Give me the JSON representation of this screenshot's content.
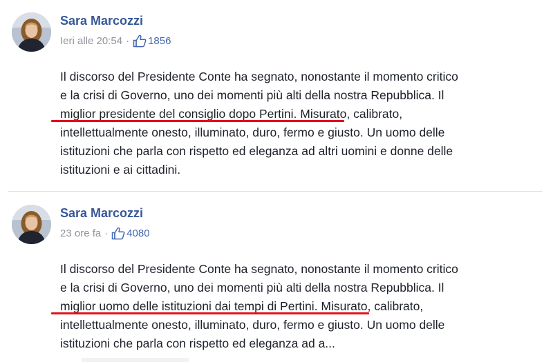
{
  "posts": [
    {
      "author": "Sara Marcozzi",
      "time": "Ieri alle 20:54",
      "separator": "·",
      "likes": "1856",
      "lines": [
        "Il discorso del Presidente Conte ha segnato, nonostante il momento critico",
        "e la crisi di Governo, uno dei momenti più alti della nostra Repubblica. Il",
        "miglior presidente del consiglio dopo Pertini. Misurato, calibrato,",
        "intellettualmente onesto, illuminato, duro, fermo e giusto. Un uomo delle",
        "istituzioni che parla con rispetto ed eleganza ad altri uomini e donne delle",
        "istituzioni e ai cittadini."
      ]
    },
    {
      "author": "Sara Marcozzi",
      "time": "23 ore fa",
      "separator": "·",
      "likes": "4080",
      "lines": [
        "Il discorso del Presidente Conte ha segnato, nonostante il momento critico",
        "e la crisi di Governo, uno dei momenti più alti della nostra Repubblica. Il",
        "miglior uomo delle istituzioni dai tempi di Pertini. Misurato, calibrato,",
        "intellettualmente onesto, illuminato, duro, fermo e giusto. Un uomo delle",
        "istituzioni che parla con rispetto ed eleganza ad a..."
      ]
    }
  ],
  "colors": {
    "author": "#365899",
    "meta": "#90949c",
    "like_count": "#4267b2",
    "text": "#1d2129",
    "underline": "#e0111a"
  },
  "icons": {
    "like": "thumbs-up-icon",
    "avatar": "profile-photo"
  }
}
